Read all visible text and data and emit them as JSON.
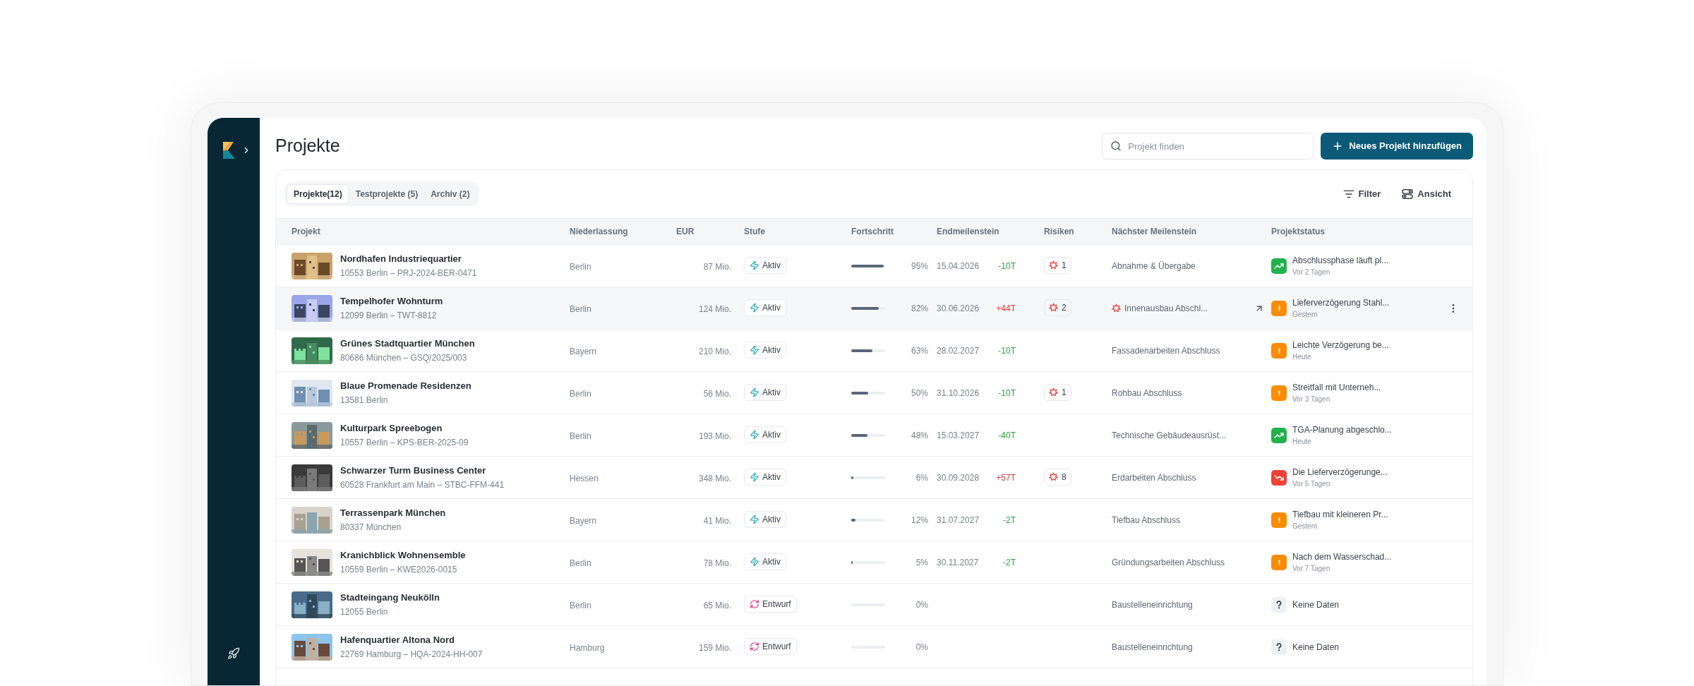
{
  "page": {
    "title": "Projekte"
  },
  "search": {
    "placeholder": "Projekt finden"
  },
  "add_button": {
    "label": "Neues Projekt hinzufügen"
  },
  "tabs": [
    {
      "label": "Projekte(12)",
      "selected": true
    },
    {
      "label": "Testprojekte (5)",
      "selected": false
    },
    {
      "label": "Archiv (2)",
      "selected": false
    }
  ],
  "toolbar": {
    "filter": "Filter",
    "view": "Ansicht"
  },
  "table": {
    "columns": [
      "Projekt",
      "Niederlassung",
      "EUR",
      "Stufe",
      "Fortschritt",
      "Endmeilenstein",
      "Risiken",
      "Nächster Meilenstein",
      "Projektstatus"
    ],
    "rows": [
      {
        "name": "Nordhafen Industriequartier",
        "subtitle": "10553 Berlin – PRJ-2024-BER-0471",
        "branch": "Berlin",
        "budget": "87 Mio.",
        "stage": {
          "kind": "active",
          "label": "Aktiv"
        },
        "progress": {
          "level": 0.95,
          "reading": "95%"
        },
        "end_milestone": {
          "date": "15.04.2026",
          "delta": "-10T",
          "late": false
        },
        "risks": "1",
        "next_milestone": {
          "label": "Abnahme & Übergabe",
          "at_risk": false
        },
        "status": {
          "kind": "up",
          "text": "Abschlussphase läuft pl...",
          "time": "Vor 2 Tagen"
        },
        "highlighted": false
      },
      {
        "name": "Tempelhofer Wohnturm",
        "subtitle": "12099 Berlin – TWT-8812",
        "branch": "Berlin",
        "budget": "124 Mio.",
        "stage": {
          "kind": "active",
          "label": "Aktiv"
        },
        "progress": {
          "level": 0.82,
          "reading": "82%"
        },
        "end_milestone": {
          "date": "30.06.2026",
          "delta": "+44T",
          "late": true
        },
        "risks": "2",
        "next_milestone": {
          "label": "Innenausbau Abschl...",
          "at_risk": true
        },
        "status": {
          "kind": "warning",
          "text": "Lieferverzögerung Stahl...",
          "time": "Gestern"
        },
        "highlighted": true
      },
      {
        "name": "Grünes Stadtquartier München",
        "subtitle": "80686 München – GSQ/2025/003",
        "branch": "Bayern",
        "budget": "210 Mio.",
        "stage": {
          "kind": "active",
          "label": "Aktiv"
        },
        "progress": {
          "level": 0.63,
          "reading": "63%"
        },
        "end_milestone": {
          "date": "28.02.2027",
          "delta": "-10T",
          "late": false
        },
        "next_milestone": {
          "label": "Fassadenarbeiten Abschluss",
          "at_risk": false
        },
        "status": {
          "kind": "warning",
          "text": "Leichte Verzögerung be...",
          "time": "Heute"
        },
        "highlighted": false
      },
      {
        "name": "Blaue Promenade Residenzen",
        "subtitle": "13581 Berlin",
        "branch": "Berlin",
        "budget": "56 Mio.",
        "stage": {
          "kind": "active",
          "label": "Aktiv"
        },
        "progress": {
          "level": 0.5,
          "reading": "50%"
        },
        "end_milestone": {
          "date": "31.10.2026",
          "delta": "-10T",
          "late": false
        },
        "risks": "1",
        "next_milestone": {
          "label": "Rohbau Abschluss",
          "at_risk": false
        },
        "status": {
          "kind": "warning",
          "text": "Streitfall mit Unterneh...",
          "time": "Vor 3 Tagen"
        },
        "highlighted": false
      },
      {
        "name": "Kulturpark Spreebogen",
        "subtitle": "10557 Berlin – KPS-BER-2025-09",
        "branch": "Berlin",
        "budget": "193 Mio.",
        "stage": {
          "kind": "active",
          "label": "Aktiv"
        },
        "progress": {
          "level": 0.48,
          "reading": "48%"
        },
        "end_milestone": {
          "date": "15.03.2027",
          "delta": "-40T",
          "late": false
        },
        "next_milestone": {
          "label": "Technische Gebäudeausrüst...",
          "at_risk": false
        },
        "status": {
          "kind": "up",
          "text": "TGA-Planung abgeschlo...",
          "time": "Heute"
        },
        "highlighted": false
      },
      {
        "name": "Schwarzer Turm Business Center",
        "subtitle": "60528 Frankfurt am Main – STBC-FFM-441",
        "branch": "Hessen",
        "budget": "348 Mio.",
        "stage": {
          "kind": "active",
          "label": "Aktiv"
        },
        "progress": {
          "level": 0.06,
          "reading": "6%"
        },
        "end_milestone": {
          "date": "30.09.2028",
          "delta": "+57T",
          "late": true
        },
        "risks": "8",
        "next_milestone": {
          "label": "Erdarbeiten Abschluss",
          "at_risk": false
        },
        "status": {
          "kind": "down",
          "text": "Die Lieferverzögerunge...",
          "time": "Vor 5 Tagen"
        },
        "highlighted": false
      },
      {
        "name": "Terrassenpark München",
        "subtitle": "80337 München",
        "branch": "Bayern",
        "budget": "41 Mio.",
        "stage": {
          "kind": "active",
          "label": "Aktiv"
        },
        "progress": {
          "level": 0.12,
          "reading": "12%"
        },
        "end_milestone": {
          "date": "31.07.2027",
          "delta": "-2T",
          "late": false
        },
        "next_milestone": {
          "label": "Tiefbau Abschluss",
          "at_risk": false
        },
        "status": {
          "kind": "warning",
          "text": "Tiefbau mit kleineren Pr...",
          "time": "Gestern"
        },
        "highlighted": false
      },
      {
        "name": "Kranichblick Wohnensemble",
        "subtitle": "10559 Berlin – KWE2026-0015",
        "branch": "Berlin",
        "budget": "78 Mio.",
        "stage": {
          "kind": "active",
          "label": "Aktiv"
        },
        "progress": {
          "level": 0.05,
          "reading": "5%"
        },
        "end_milestone": {
          "date": "30.11.2027",
          "delta": "-2T",
          "late": false
        },
        "next_milestone": {
          "label": "Gründungsarbeiten Abschluss",
          "at_risk": false
        },
        "status": {
          "kind": "warning",
          "text": "Nach dem Wasserschad...",
          "time": "Vor 7 Tagen"
        },
        "highlighted": false
      },
      {
        "name": "Stadteingang Neukölln",
        "subtitle": "12055 Berlin",
        "branch": "Berlin",
        "budget": "65 Mio.",
        "stage": {
          "kind": "draft",
          "label": "Entwurf"
        },
        "progress": {
          "level": 0,
          "reading": "0%"
        },
        "next_milestone": {
          "label": "Baustelleneinrichtung",
          "at_risk": false
        },
        "status": {
          "kind": "unknown",
          "text": "Keine Daten"
        },
        "highlighted": false
      },
      {
        "name": "Hafenquartier Altona Nord",
        "subtitle": "22769 Hamburg – HQA-2024-HH-007",
        "branch": "Hamburg",
        "budget": "159 Mio.",
        "stage": {
          "kind": "draft",
          "label": "Entwurf"
        },
        "progress": {
          "level": 0,
          "reading": "0%"
        },
        "next_milestone": {
          "label": "Baustelleneinrichtung",
          "at_risk": false
        },
        "status": {
          "kind": "unknown",
          "text": "Keine Daten"
        },
        "highlighted": false
      }
    ]
  }
}
